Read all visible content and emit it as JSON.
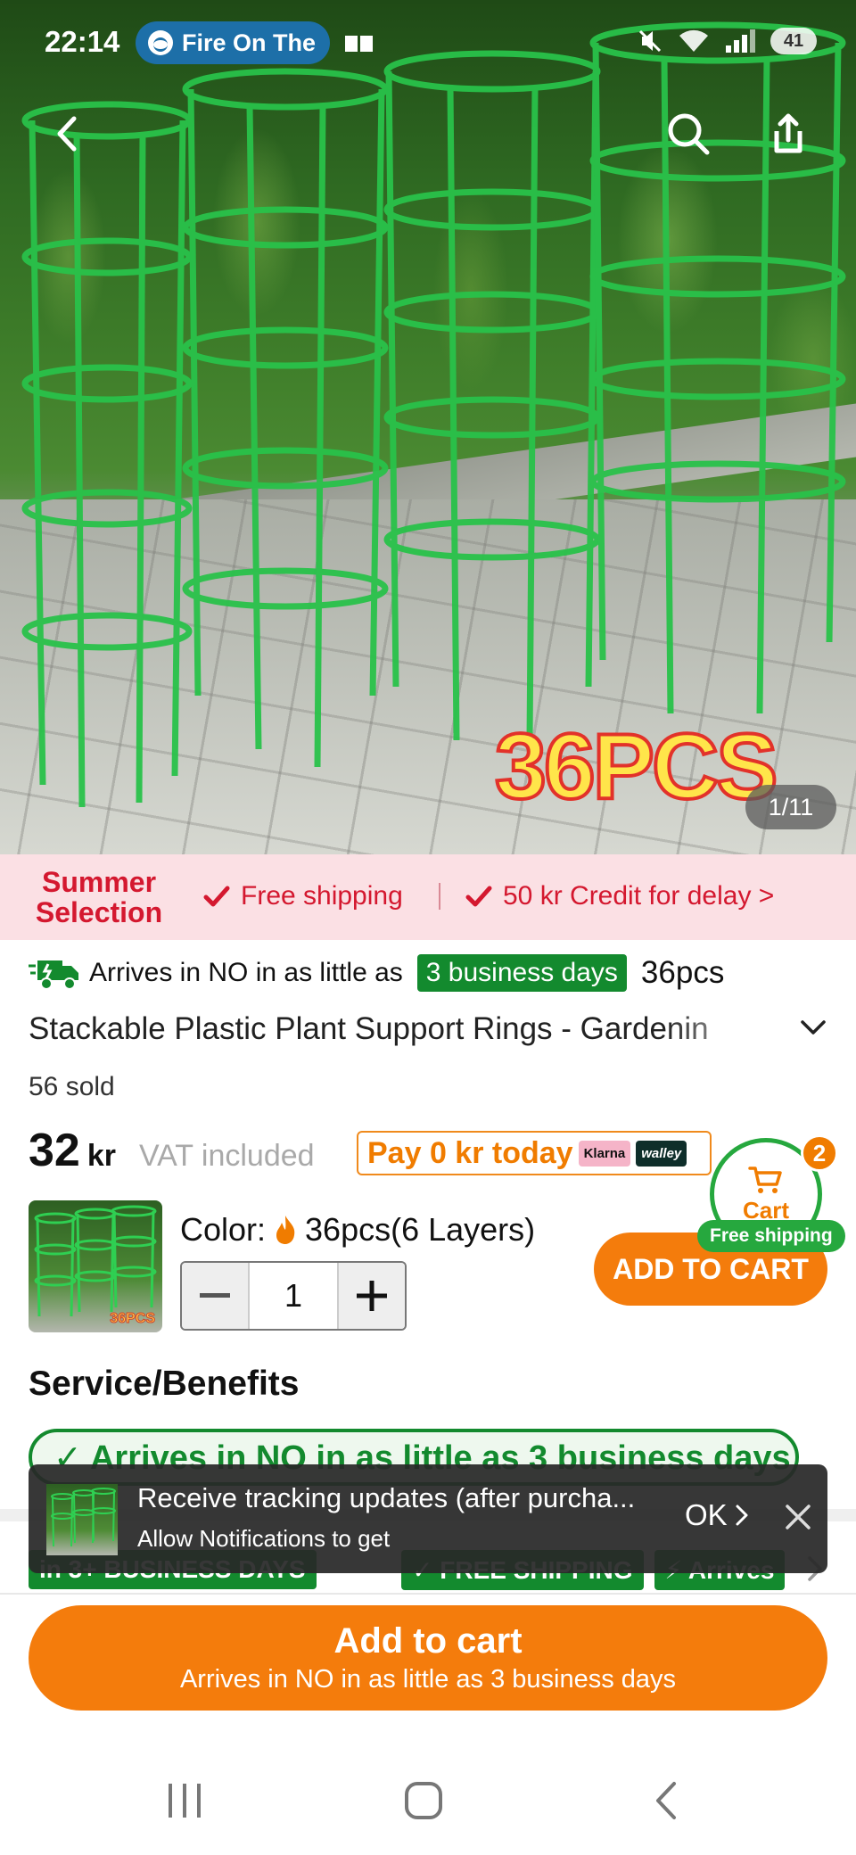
{
  "status_bar": {
    "time": "22:14",
    "media_chip": "Fire On The",
    "battery": "41"
  },
  "hero": {
    "overlay_text": "36PCS",
    "image_counter": "1/11",
    "icons": [
      "back-icon",
      "search-icon",
      "share-icon"
    ]
  },
  "promo": {
    "badge": "Summer Selection",
    "free_shipping": "Free shipping",
    "credit": "50 kr Credit for delay >"
  },
  "product": {
    "arrives_prefix": "Arrives in NO in as little as",
    "arrives_badge": "3 business days",
    "title_start": "36pcs",
    "title": "Stackable Plastic Plant Support Rings - Gardenin",
    "sold": "56 sold",
    "price_number": "32",
    "price_currency": "kr",
    "vat": "VAT included",
    "pay_later": "Pay 0 kr today",
    "pay_providers": [
      "Klarna",
      "walley"
    ]
  },
  "cart": {
    "label": "Cart",
    "count": "2",
    "free_shipping": "Free shipping"
  },
  "variant": {
    "color_label": "Color:",
    "color_value": "36pcs(6 Layers)",
    "thumb_text": "36PCS",
    "quantity": "1",
    "add_to_cart": "ADD TO CART"
  },
  "service": {
    "heading": "Service/Benefits",
    "arrives_pill": "✓ Arrives in NO in as little as 3 business days",
    "tags": [
      "in 3+ BUSINESS DAYS",
      "✓ FREE SHIPPING",
      "⚡ Arrives"
    ]
  },
  "toast": {
    "title": "Receive tracking updates (after purcha...",
    "subtitle": "Allow Notifications to get",
    "ok": "OK"
  },
  "bottom": {
    "button_title": "Add to cart",
    "button_sub": "Arrives in NO in as little as 3 business days"
  },
  "colors": {
    "orange": "#f47c0c",
    "green": "#138a2e",
    "red": "#d4182f",
    "promo_bg": "#fbe0e4"
  }
}
